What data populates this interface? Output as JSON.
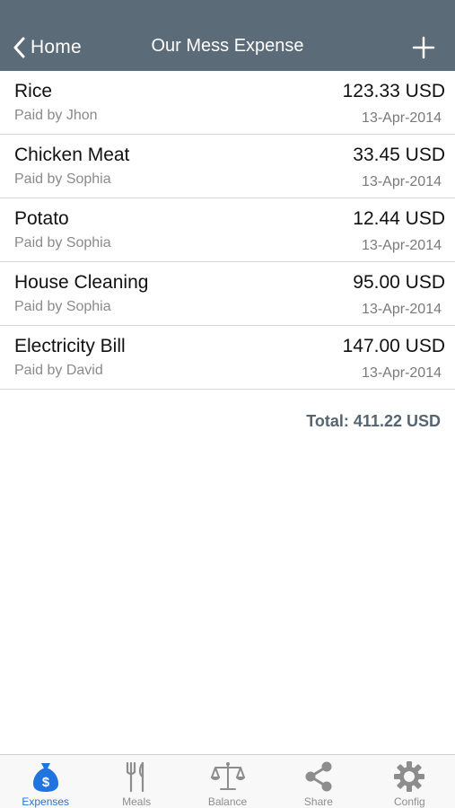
{
  "navbar": {
    "back_label": "Home",
    "title": "Our Mess Expense"
  },
  "expenses": [
    {
      "name": "Rice",
      "paid_by": "Paid by Jhon",
      "amount": "123.33 USD",
      "date": "13-Apr-2014"
    },
    {
      "name": "Chicken Meat",
      "paid_by": "Paid by Sophia",
      "amount": "33.45 USD",
      "date": "13-Apr-2014"
    },
    {
      "name": "Potato",
      "paid_by": "Paid by Sophia",
      "amount": "12.44 USD",
      "date": "13-Apr-2014"
    },
    {
      "name": "House Cleaning",
      "paid_by": "Paid by Sophia",
      "amount": "95.00 USD",
      "date": "13-Apr-2014"
    },
    {
      "name": "Electricity Bill",
      "paid_by": "Paid by David",
      "amount": "147.00 USD",
      "date": "13-Apr-2014"
    }
  ],
  "total": "Total: 411.22 USD",
  "tabs": [
    {
      "label": "Expenses",
      "icon": "money-bag-icon",
      "active": true
    },
    {
      "label": "Meals",
      "icon": "fork-knife-icon",
      "active": false
    },
    {
      "label": "Balance",
      "icon": "scale-icon",
      "active": false
    },
    {
      "label": "Share",
      "icon": "share-icon",
      "active": false
    },
    {
      "label": "Config",
      "icon": "gear-icon",
      "active": false
    }
  ],
  "colors": {
    "navbar_bg": "#5b6b78",
    "accent": "#1f74e0",
    "total_text": "#566572",
    "inactive_tab": "#8d8d8d"
  }
}
